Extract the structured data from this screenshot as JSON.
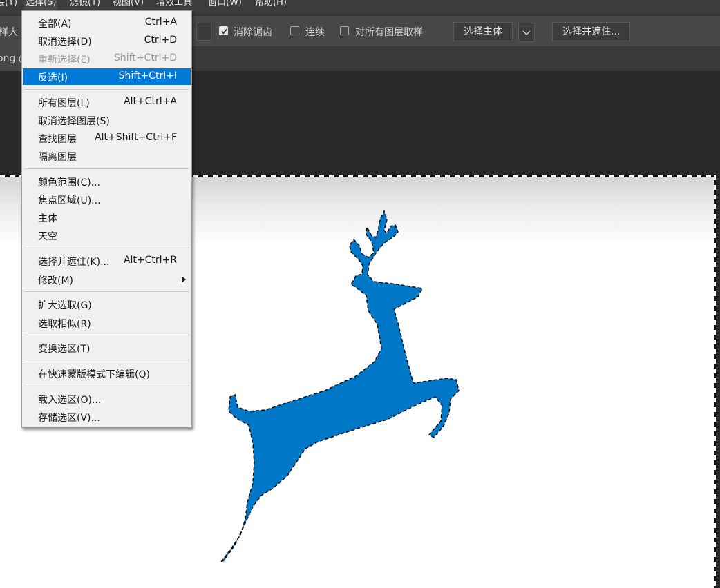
{
  "menubar": {
    "items": [
      {
        "label": "层(Y)",
        "active": false
      },
      {
        "label": "选择(S)",
        "active": true
      },
      {
        "label": "滤镜(T)",
        "active": false
      },
      {
        "label": "视图(V)",
        "active": false
      },
      {
        "label": "增效工具",
        "active": false
      },
      {
        "label": "窗口(W)",
        "active": false
      },
      {
        "label": "帮助(H)",
        "active": false
      }
    ]
  },
  "options": {
    "sample_size_label": "样大",
    "anti_alias": {
      "label": "消除锯齿",
      "checked": true
    },
    "contiguous": {
      "label": "连续",
      "checked": false
    },
    "sample_all_layers": {
      "label": "对所有图层取样",
      "checked": false
    },
    "select_subject_button": "选择主体",
    "select_and_mask_button": "选择并遮住..."
  },
  "document_tab": {
    "label": "ong @"
  },
  "select_menu": {
    "groups": [
      [
        {
          "label": "全部(A)",
          "shortcut": "Ctrl+A"
        },
        {
          "label": "取消选择(D)",
          "shortcut": "Ctrl+D"
        },
        {
          "label": "重新选择(E)",
          "shortcut": "Shift+Ctrl+D",
          "disabled": true
        },
        {
          "label": "反选(I)",
          "shortcut": "Shift+Ctrl+I",
          "highlighted": true
        }
      ],
      [
        {
          "label": "所有图层(L)",
          "shortcut": "Alt+Ctrl+A"
        },
        {
          "label": "取消选择图层(S)",
          "shortcut": ""
        },
        {
          "label": "查找图层",
          "shortcut": "Alt+Shift+Ctrl+F"
        },
        {
          "label": "隔离图层",
          "shortcut": ""
        }
      ],
      [
        {
          "label": "颜色范围(C)...",
          "shortcut": ""
        },
        {
          "label": "焦点区域(U)...",
          "shortcut": ""
        },
        {
          "label": "主体",
          "shortcut": ""
        },
        {
          "label": "天空",
          "shortcut": ""
        }
      ],
      [
        {
          "label": "选择并遮住(K)...",
          "shortcut": "Alt+Ctrl+R"
        },
        {
          "label": "修改(M)",
          "shortcut": "",
          "submenu": true
        }
      ],
      [
        {
          "label": "扩大选取(G)",
          "shortcut": ""
        },
        {
          "label": "选取相似(R)",
          "shortcut": ""
        }
      ],
      [
        {
          "label": "变换选区(T)",
          "shortcut": ""
        }
      ],
      [
        {
          "label": "在快速蒙版模式下编辑(Q)",
          "shortcut": ""
        }
      ],
      [
        {
          "label": "载入选区(O)...",
          "shortcut": ""
        },
        {
          "label": "存储选区(V)...",
          "shortcut": ""
        }
      ]
    ]
  },
  "colors": {
    "deer_fill": "#0078c8",
    "menu_highlight": "#0078d7",
    "menu_bg": "#f0f0f0"
  }
}
